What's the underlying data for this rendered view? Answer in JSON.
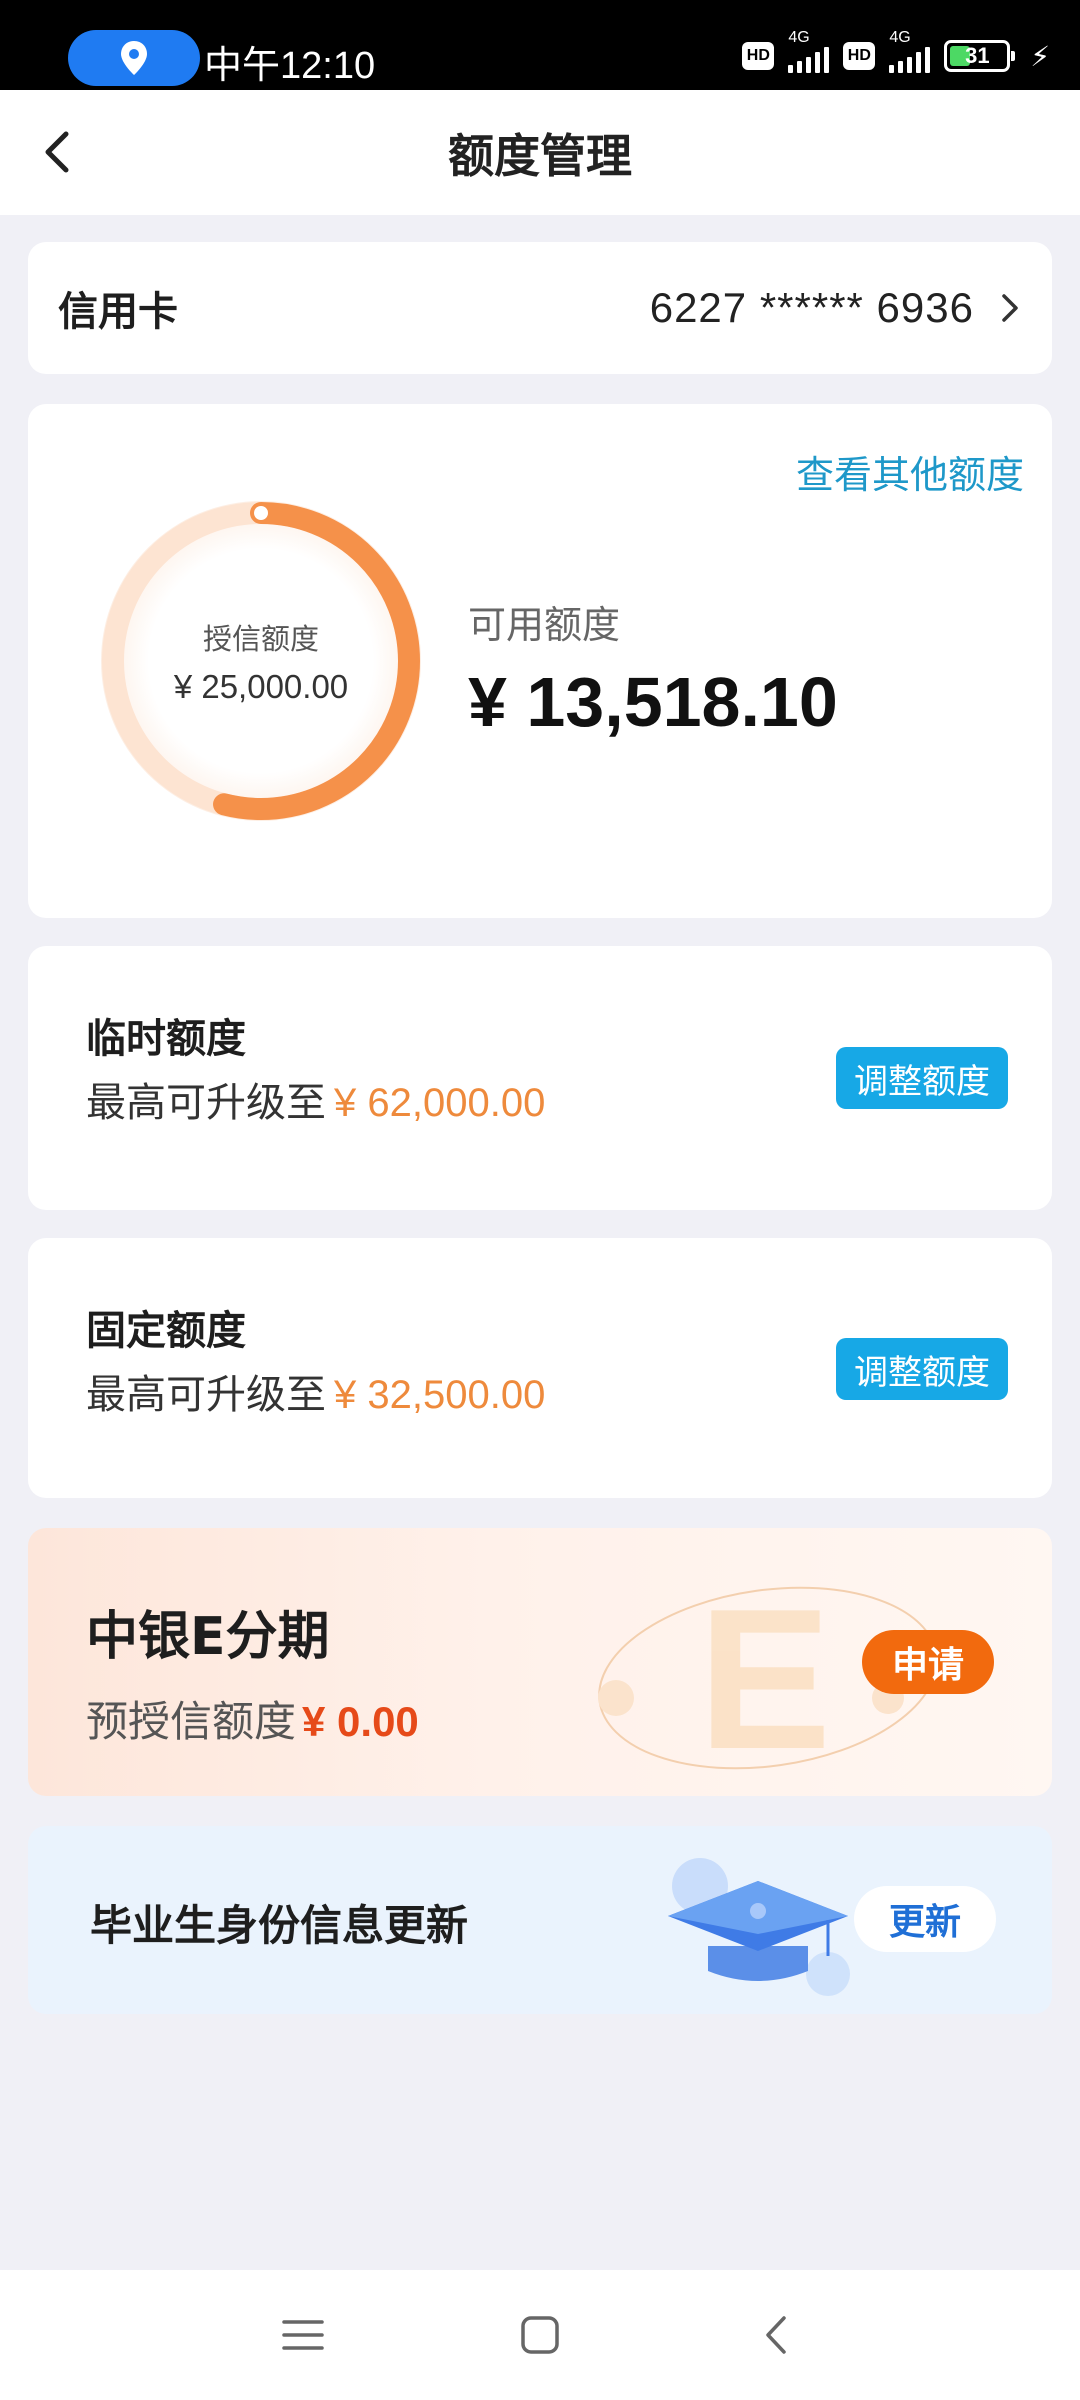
{
  "status_bar": {
    "time": "中午12:10",
    "network_1": "4G",
    "network_2": "4G",
    "hd_1": "HD",
    "hd_2": "HD",
    "battery": "31",
    "icons": [
      "location-icon",
      "signal-icon",
      "battery-icon",
      "charging-icon"
    ]
  },
  "nav": {
    "title": "额度管理",
    "back_icon": "back-arrow-icon"
  },
  "card_selector": {
    "label": "信用卡",
    "number": "6227 ****** 6936",
    "icon": "chevron-right-icon"
  },
  "limit_overview": {
    "other_link": "查看其他额度",
    "credit_label": "授信额度",
    "credit_value": "¥ 25,000.00",
    "available_label": "可用额度",
    "available_value": "¥ 13,518.10",
    "ring_fill_fraction": 0.54,
    "ring_color": "#f5914a"
  },
  "temp_limit": {
    "title": "临时额度",
    "sub_prefix": "最高可升级至",
    "amount": "¥ 62,000.00",
    "button": "调整额度"
  },
  "fixed_limit": {
    "title": "固定额度",
    "sub_prefix": "最高可升级至",
    "amount": "¥ 32,500.00",
    "button": "调整额度"
  },
  "installment": {
    "title": "中银E分期",
    "sub_prefix": "预授信额度",
    "amount": "¥ 0.00",
    "button": "申请"
  },
  "graduate": {
    "title": "毕业生身份信息更新",
    "button": "更新",
    "icon": "graduation-cap-icon"
  },
  "system_nav": {
    "icons": [
      "menu-icon",
      "home-icon",
      "back-icon"
    ]
  },
  "colors": {
    "accent_blue": "#17a8e6",
    "link_blue": "#1e98c9",
    "amount_orange": "#ee8a3c",
    "apply_orange": "#f26a0e",
    "zero_red": "#e64a19"
  }
}
